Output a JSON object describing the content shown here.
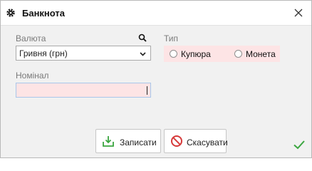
{
  "window": {
    "title": "Банкнота"
  },
  "form": {
    "currency": {
      "label": "Валюта",
      "value": "Гривня (грн)"
    },
    "type": {
      "label": "Тип",
      "options": [
        "Купюра",
        "Монета"
      ]
    },
    "nominal": {
      "label": "Номінал",
      "value": ""
    }
  },
  "buttons": {
    "save": "Записати",
    "cancel": "Скасувати"
  },
  "colors": {
    "required_bg": "#fde4e5",
    "save_green": "#3aa63f",
    "cancel_red": "#d63a3a"
  },
  "icons": [
    "gear-icon",
    "close-icon",
    "search-icon",
    "chevron-down-icon",
    "download-save-icon",
    "cancel-icon",
    "check-icon"
  ]
}
